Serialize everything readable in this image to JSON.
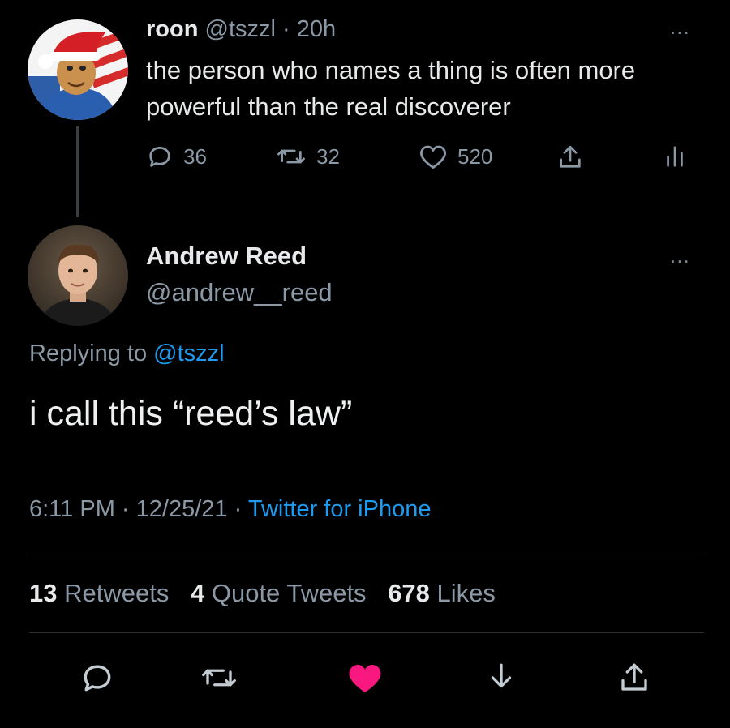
{
  "parent_tweet": {
    "name": "roon",
    "handle": "@tszzl",
    "separator": "·",
    "time": "20h",
    "text": "the person who names a thing is often more powerful than the real discoverer",
    "replies": "36",
    "retweets": "32",
    "likes": "520",
    "more_label": "..."
  },
  "reply_tweet": {
    "name": "Andrew Reed",
    "handle": "@andrew__reed",
    "more_label": "...",
    "replying_prefix": "Replying to",
    "replying_handle": "@tszzl",
    "text": "i call this “reed’s law”",
    "time": "6:11 PM",
    "date": "12/25/21",
    "separator": "·",
    "source": "Twitter for iPhone"
  },
  "engagement": {
    "retweets_count": "13",
    "retweets_label": "Retweets",
    "quotes_count": "4",
    "quotes_label": "Quote Tweets",
    "likes_count": "678",
    "likes_label": "Likes"
  },
  "colors": {
    "background": "#000000",
    "text": "#e7e9ea",
    "muted": "#8b98a5",
    "accent": "#1d9bf0",
    "like_active": "#f91880"
  },
  "icons": {
    "reply": "speech-bubble-icon",
    "retweet": "retweet-arrows-icon",
    "like": "heart-icon",
    "share": "share-upload-icon",
    "analytics": "bar-chart-icon",
    "bookmark": "download-arrow-icon"
  }
}
